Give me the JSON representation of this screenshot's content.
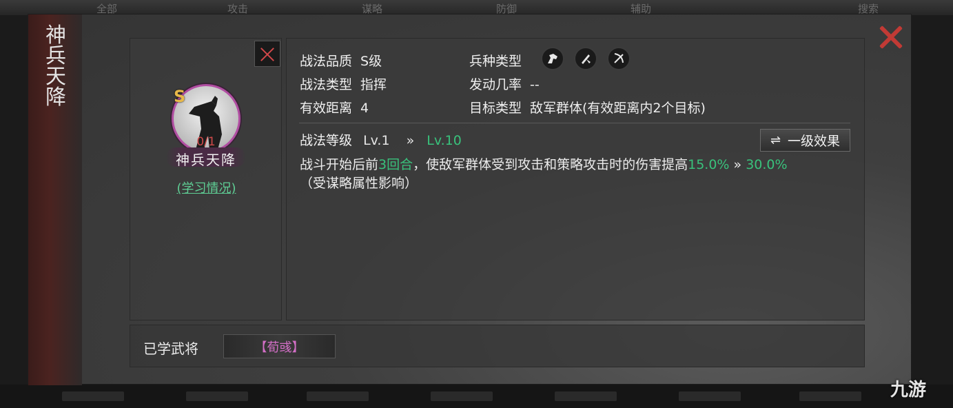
{
  "background": {
    "tabs": [
      "全部",
      "攻击",
      "谋略",
      "防御",
      "辅助",
      "搜索"
    ]
  },
  "modal": {
    "side_title": "神兵天降",
    "skill_card": {
      "quality_letter": "S",
      "learn_count": "0/1",
      "name": "神兵天降",
      "learn_status": "(学习情况)"
    },
    "info": {
      "quality_label": "战法品质",
      "quality_value": "S级",
      "troop_label": "兵种类型",
      "type_label": "战法类型",
      "type_value": "指挥",
      "rate_label": "发动几率",
      "rate_value": "--",
      "range_label": "有效距离",
      "range_value": "4",
      "target_label": "目标类型",
      "target_value": "敌军群体(有效距离内2个目标)",
      "troop_icons": [
        "cavalry-icon",
        "spear-icon",
        "archer-icon"
      ]
    },
    "level": {
      "label": "战法等级",
      "from": "Lv.1",
      "arrow": "»",
      "to": "Lv.10"
    },
    "effect_button": "一级效果",
    "description": {
      "part1": "战斗开始后前",
      "rounds": "3回合",
      "part2": "，使敌军群体受到攻击和策略攻击时的伤害提高",
      "from_pct": "15.0%",
      "arrow": " » ",
      "to_pct": "30.0%",
      "note": "（受谋略属性影响）"
    },
    "learned": {
      "label": "已学武将",
      "general": "【荀彧】"
    }
  },
  "watermark": "九游",
  "colors": {
    "accent_green": "#39c27c",
    "close_red": "#c23a35",
    "general_pink": "#d36fc7",
    "quality_gold": "#e8b84a"
  }
}
